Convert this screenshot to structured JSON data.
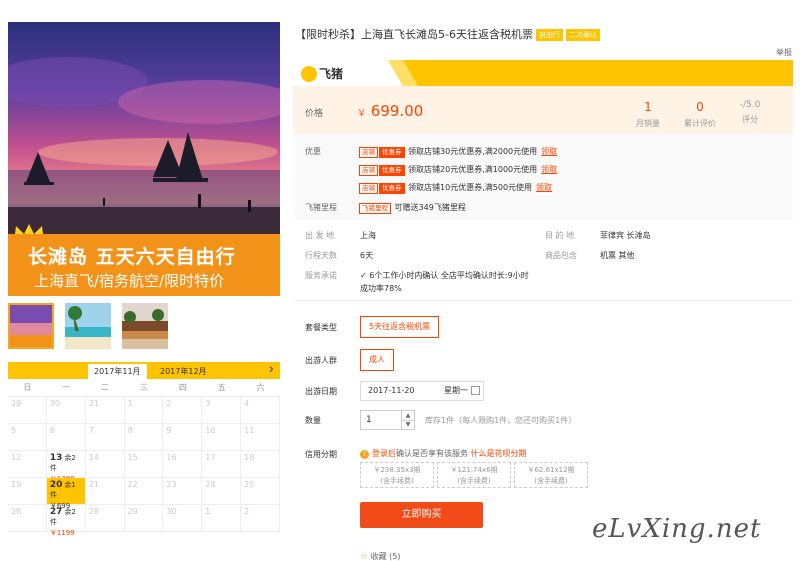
{
  "hero": {
    "headline": "长滩岛  五天六天自由行",
    "subline": "上海直飞/宿务航空/限时特价"
  },
  "thumbnails": [
    "thumb-1",
    "thumb-2",
    "thumb-3"
  ],
  "calendar": {
    "tabs": [
      "2017年11月",
      "2017年12月"
    ],
    "next_icon": "chevron-right-icon",
    "weekdays": [
      "日",
      "一",
      "二",
      "三",
      "四",
      "五",
      "六"
    ],
    "cells": [
      {
        "d": "29"
      },
      {
        "d": "30"
      },
      {
        "d": "31"
      },
      {
        "d": "1"
      },
      {
        "d": "2"
      },
      {
        "d": "3"
      },
      {
        "d": "4"
      },
      {
        "d": "5"
      },
      {
        "d": "6"
      },
      {
        "d": "7"
      },
      {
        "d": "8"
      },
      {
        "d": "9"
      },
      {
        "d": "10"
      },
      {
        "d": "11"
      },
      {
        "d": "12"
      },
      {
        "d": "13",
        "rem": "余2件",
        "price": "￥1399"
      },
      {
        "d": "14"
      },
      {
        "d": "15"
      },
      {
        "d": "16"
      },
      {
        "d": "17"
      },
      {
        "d": "18"
      },
      {
        "d": "19"
      },
      {
        "d": "20",
        "rem": "余1件",
        "price": "￥699",
        "selected": true
      },
      {
        "d": "21"
      },
      {
        "d": "22"
      },
      {
        "d": "23"
      },
      {
        "d": "24"
      },
      {
        "d": "25"
      },
      {
        "d": "26"
      },
      {
        "d": "27",
        "rem": "余2件",
        "price": "￥1199"
      },
      {
        "d": "28"
      },
      {
        "d": "29"
      },
      {
        "d": "30"
      },
      {
        "d": "1"
      },
      {
        "d": "2"
      }
    ]
  },
  "product": {
    "title": "【限时秒杀】上海直飞长滩岛5-6天往返含税机票",
    "tags": [
      "自由行",
      "二次确认"
    ],
    "report": "举报",
    "brand": "飞猪"
  },
  "price": {
    "label": "价格",
    "currency": "￥",
    "value": "699.00",
    "monthly_sales": "1",
    "monthly_sales_label": "月销量",
    "reviews": "0",
    "reviews_label": "累计评价",
    "rating": "-/5.0",
    "rating_label": "评分"
  },
  "promo": {
    "label": "优惠",
    "shop_badge": "店铺",
    "coupon_badge": "优惠券",
    "coupons": [
      "领取店铺30元优惠券,满2000元使用",
      "领取店铺20元优惠券,满1000元使用",
      "领取店铺10元优惠券,满500元使用"
    ],
    "claim": "领取",
    "mileage_label": "飞猪里程",
    "mileage_badge": "飞猪里程",
    "mileage_text": "可赠送349飞猪里程"
  },
  "details": {
    "depart_label": "出 发 地",
    "depart": "上海",
    "dest_label": "目 的 地",
    "dest": "菲律宾  长滩岛",
    "days_label": "行程天数",
    "days": "6天",
    "includes_label": "商品包含",
    "includes": "机票  其他",
    "promise_label": "服务承诺",
    "promise": "6个工作小时内确认 全店平均确认时长:9小时",
    "promise2": "成功率78%"
  },
  "options": {
    "package_label": "套餐类型",
    "package": "5天往返含税机票",
    "traveler_label": "出游人群",
    "traveler": "成人",
    "date_label": "出游日期",
    "date": "2017-11-20",
    "weekday": "星期一",
    "qty_label": "数量",
    "qty": "1",
    "stock": "库存1件（每人限购1件，您还可购买1件）"
  },
  "credit": {
    "label": "信用分期",
    "note_link": "登录后",
    "note": "确认是否享有该服务 ",
    "note_link2": "什么是花呗分期",
    "plans": [
      {
        "amount": "￥238.35x3期",
        "fee": "(含手续费)"
      },
      {
        "amount": "￥121.74x6期",
        "fee": "(含手续费)"
      },
      {
        "amount": "￥62.61x12期",
        "fee": "(含手续费)"
      }
    ]
  },
  "actions": {
    "buy": "立即购买",
    "favorite": "收藏",
    "favorite_count": "(5)"
  },
  "watermark": "eLvXing.net"
}
